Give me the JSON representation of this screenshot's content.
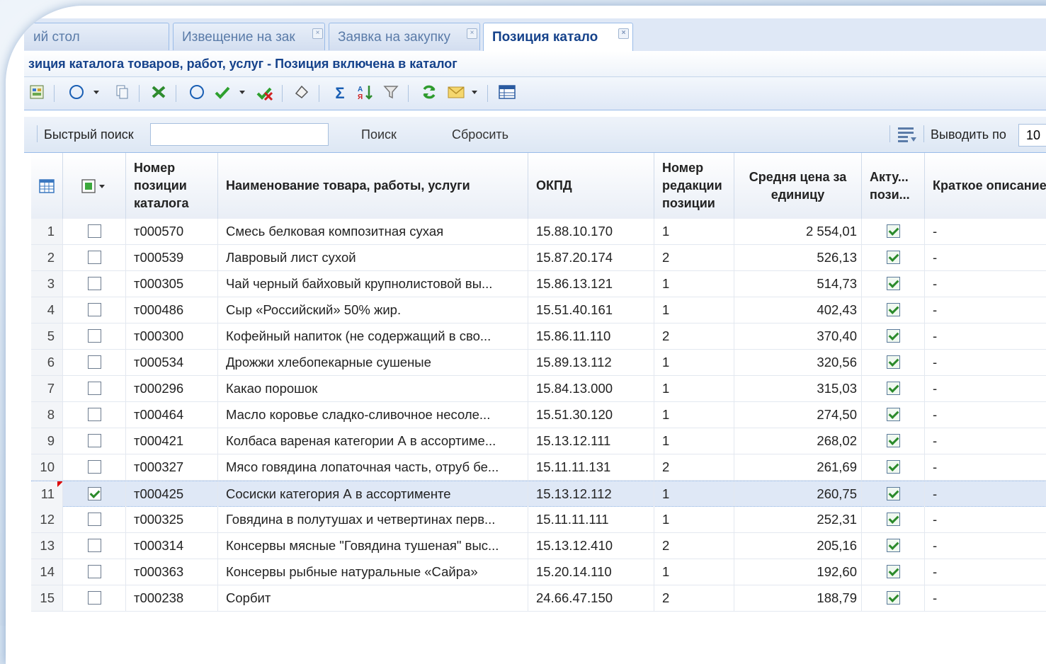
{
  "tabs": [
    {
      "label": "ий стол"
    },
    {
      "label": "Извещение на зак"
    },
    {
      "label": "Заявка на закупку"
    },
    {
      "label": "Позиция катало"
    }
  ],
  "title": "зиция каталога товаров, работ, услуг - Позиция включена в каталог",
  "search": {
    "label": "Быстрый поиск",
    "value": "",
    "search_button": "Поиск",
    "reset_button": "Сбросить",
    "output_label": "Выводить по",
    "output_value": "10"
  },
  "columns": [
    "Номер позиции каталога",
    "Наименование товара, работы, услуги",
    "ОКПД",
    "Номер редакции позиции",
    "Средня цена за единицу",
    "Акту... пози...",
    "Краткое описание"
  ],
  "rows": [
    {
      "n": "1",
      "checked": false,
      "code": "т000570",
      "name": "Смесь белковая композитная сухая",
      "okpd": "15.88.10.170",
      "rev": "1",
      "price": "2 554,01",
      "active": true,
      "desc": "-"
    },
    {
      "n": "2",
      "checked": false,
      "code": "т000539",
      "name": "Лавровый лист сухой",
      "okpd": "15.87.20.174",
      "rev": "2",
      "price": "526,13",
      "active": true,
      "desc": "-"
    },
    {
      "n": "3",
      "checked": false,
      "code": "т000305",
      "name": "Чай черный байховый крупнолистовой вы...",
      "okpd": "15.86.13.121",
      "rev": "1",
      "price": "514,73",
      "active": true,
      "desc": "-"
    },
    {
      "n": "4",
      "checked": false,
      "code": "т000486",
      "name": "Сыр «Российский» 50% жир.",
      "okpd": "15.51.40.161",
      "rev": "1",
      "price": "402,43",
      "active": true,
      "desc": "-"
    },
    {
      "n": "5",
      "checked": false,
      "code": "т000300",
      "name": "Кофейный напиток (не содержащий в сво...",
      "okpd": "15.86.11.110",
      "rev": "2",
      "price": "370,40",
      "active": true,
      "desc": "-"
    },
    {
      "n": "6",
      "checked": false,
      "code": "т000534",
      "name": "Дрожжи хлебопекарные сушеные",
      "okpd": "15.89.13.112",
      "rev": "1",
      "price": "320,56",
      "active": true,
      "desc": "-"
    },
    {
      "n": "7",
      "checked": false,
      "code": "т000296",
      "name": "Какао порошок",
      "okpd": "15.84.13.000",
      "rev": "1",
      "price": "315,03",
      "active": true,
      "desc": "-"
    },
    {
      "n": "8",
      "checked": false,
      "code": "т000464",
      "name": "Масло коровье сладко-сливочное несоле...",
      "okpd": "15.51.30.120",
      "rev": "1",
      "price": "274,50",
      "active": true,
      "desc": "-"
    },
    {
      "n": "9",
      "checked": false,
      "code": "т000421",
      "name": "Колбаса вареная категории А в ассортиме...",
      "okpd": "15.13.12.111",
      "rev": "1",
      "price": "268,02",
      "active": true,
      "desc": "-"
    },
    {
      "n": "10",
      "checked": false,
      "code": "т000327",
      "name": "Мясо говядина лопаточная часть, отруб бе...",
      "okpd": "15.11.11.131",
      "rev": "2",
      "price": "261,69",
      "active": true,
      "desc": "-"
    },
    {
      "n": "11",
      "checked": true,
      "code": "т000425",
      "name": "Сосиски категория А в ассортименте",
      "okpd": "15.13.12.112",
      "rev": "1",
      "price": "260,75",
      "active": true,
      "desc": "-"
    },
    {
      "n": "12",
      "checked": false,
      "code": "т000325",
      "name": "Говядина в полутушах и четвертинах перв...",
      "okpd": "15.11.11.111",
      "rev": "1",
      "price": "252,31",
      "active": true,
      "desc": "-"
    },
    {
      "n": "13",
      "checked": false,
      "code": "т000314",
      "name": "Консервы мясные \"Говядина тушеная\" выс...",
      "okpd": "15.13.12.410",
      "rev": "2",
      "price": "205,16",
      "active": true,
      "desc": "-"
    },
    {
      "n": "14",
      "checked": false,
      "code": "т000363",
      "name": "Консервы рыбные натуральные «Сайра»",
      "okpd": "15.20.14.110",
      "rev": "1",
      "price": "192,60",
      "active": true,
      "desc": "-"
    },
    {
      "n": "15",
      "checked": false,
      "code": "т000238",
      "name": "Сорбит",
      "okpd": "24.66.47.150",
      "rev": "2",
      "price": "188,79",
      "active": true,
      "desc": "-"
    }
  ]
}
